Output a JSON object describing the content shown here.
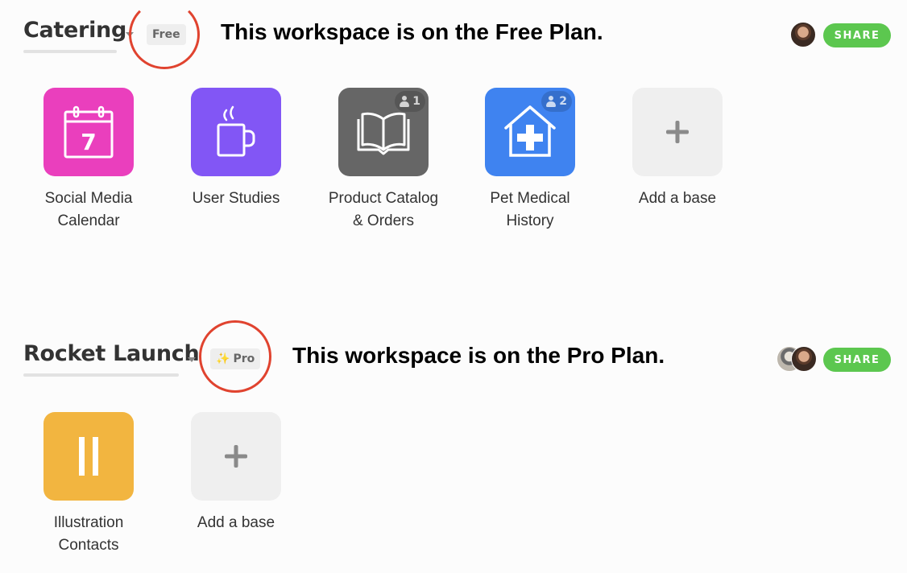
{
  "workspaces": [
    {
      "name": "Catering",
      "plan_badge": "Free",
      "plan_badge_icon": "",
      "annotation": "This workspace is on the Free Plan.",
      "share_label": "SHARE",
      "collaborator_avatars": [
        "user-avatar"
      ],
      "bases": [
        {
          "name": "Social Media Calendar",
          "line1": "Social Media",
          "line2": "Calendar",
          "color": "#ea3fbd",
          "icon": "calendar-icon",
          "icon_text": "7",
          "collaborators": null
        },
        {
          "name": "User Studies",
          "line1": "User Studies",
          "line2": "",
          "color": "#8256f5",
          "icon": "coffee-mug-icon",
          "collaborators": null
        },
        {
          "name": "Product Catalog & Orders",
          "line1": "Product Catalog",
          "line2": "& Orders",
          "color": "#666666",
          "icon": "open-book-icon",
          "collaborators": "1"
        },
        {
          "name": "Pet Medical History",
          "line1": "Pet Medical",
          "line2": "History",
          "color": "#3f83f0",
          "icon": "medical-house-icon",
          "collaborators": "2"
        }
      ],
      "add_base_label": "Add a base"
    },
    {
      "name": "Rocket Launch",
      "plan_badge": "Pro",
      "plan_badge_icon": "✨",
      "annotation": "This workspace is on the Pro Plan.",
      "share_label": "SHARE",
      "collaborator_avatars": [
        "cat-avatar",
        "user-avatar"
      ],
      "bases": [
        {
          "name": "Illustration Contacts",
          "line1": "Illustration",
          "line2": "Contacts",
          "color": "#f2b540",
          "icon": "pause-bars-icon",
          "collaborators": null
        }
      ],
      "add_base_label": "Add a base"
    }
  ],
  "colors": {
    "annotation_circle": "#e0432f",
    "share_button": "#5cc74f",
    "add_tile": "#efefef"
  }
}
